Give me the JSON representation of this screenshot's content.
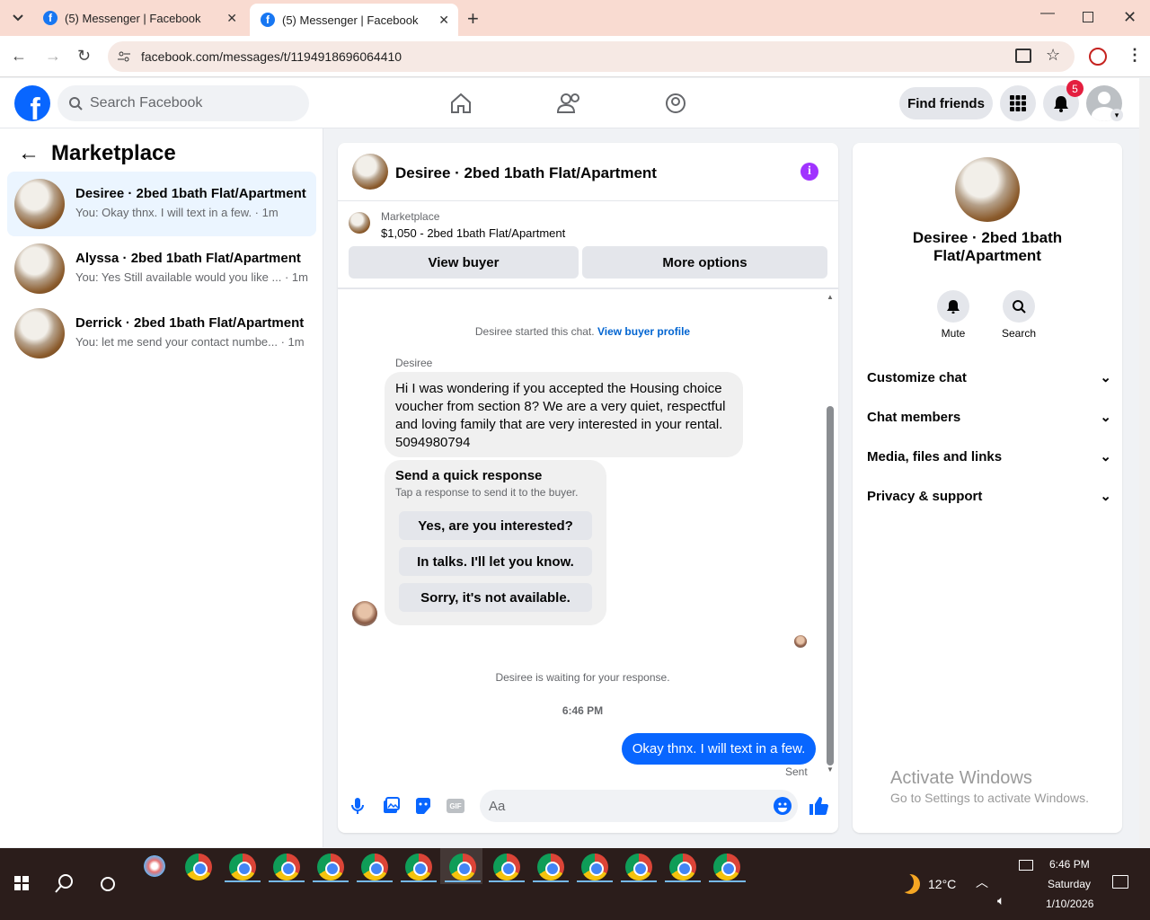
{
  "browser": {
    "tabs": [
      {
        "title": "(5) Messenger | Facebook"
      },
      {
        "title": "(5) Messenger | Facebook"
      }
    ],
    "url": "facebook.com/messages/t/1194918696064410"
  },
  "facebook": {
    "search_placeholder": "Search Facebook",
    "find_friends": "Find friends",
    "notification_count": "5"
  },
  "sidebar": {
    "title": "Marketplace",
    "conversations": [
      {
        "name": "Desiree · 2bed 1bath Flat/Apartment",
        "preview": "You: Okay thnx. I will text in a few. · 1m"
      },
      {
        "name": "Alyssa · 2bed 1bath Flat/Apartment",
        "preview": "You: Yes Still available would you like ... · 1m"
      },
      {
        "name": "Derrick · 2bed 1bath Flat/Apartment",
        "preview": "You: let me send your contact numbe... · 1m"
      }
    ]
  },
  "chat": {
    "title": "Desiree · 2bed 1bath Flat/Apartment",
    "listing_label": "Marketplace",
    "listing_info": "$1,050 - 2bed 1bath Flat/Apartment",
    "view_buyer": "View buyer",
    "more_options": "More options",
    "started_text": "Desiree started this chat.",
    "view_profile": "View buyer profile",
    "sender_name": "Desiree",
    "message": "Hi I was wondering if you accepted the Housing choice voucher from section 8?  We are a very quiet, respectful and loving family that are very interested in your rental. 5094980794",
    "quick_title": "Send a quick response",
    "quick_sub": "Tap a response to send it to the buyer.",
    "quick_responses": [
      "Yes, are you interested?",
      "In talks. I'll let you know.",
      "Sorry, it's not available."
    ],
    "waiting": "Desiree is waiting for your response.",
    "time": "6:46 PM",
    "my_message": "Okay thnx. I will text in a few.",
    "sent": "Sent",
    "input_placeholder": "Aa"
  },
  "info": {
    "name": "Desiree · 2bed 1bath Flat/Apartment",
    "mute": "Mute",
    "search": "Search",
    "sections": [
      "Customize chat",
      "Chat members",
      "Media, files and links",
      "Privacy & support"
    ],
    "watermark_title": "Activate Windows",
    "watermark_sub": "Go to Settings to activate Windows."
  },
  "taskbar": {
    "weather": "12°C",
    "clock_time": "6:46 PM",
    "clock_day": "Saturday",
    "clock_date": "1/10/2026"
  },
  "colors": {
    "fb_blue": "#0866ff",
    "link_blue": "#0064d1",
    "messenger_purple": "#a033ff"
  }
}
